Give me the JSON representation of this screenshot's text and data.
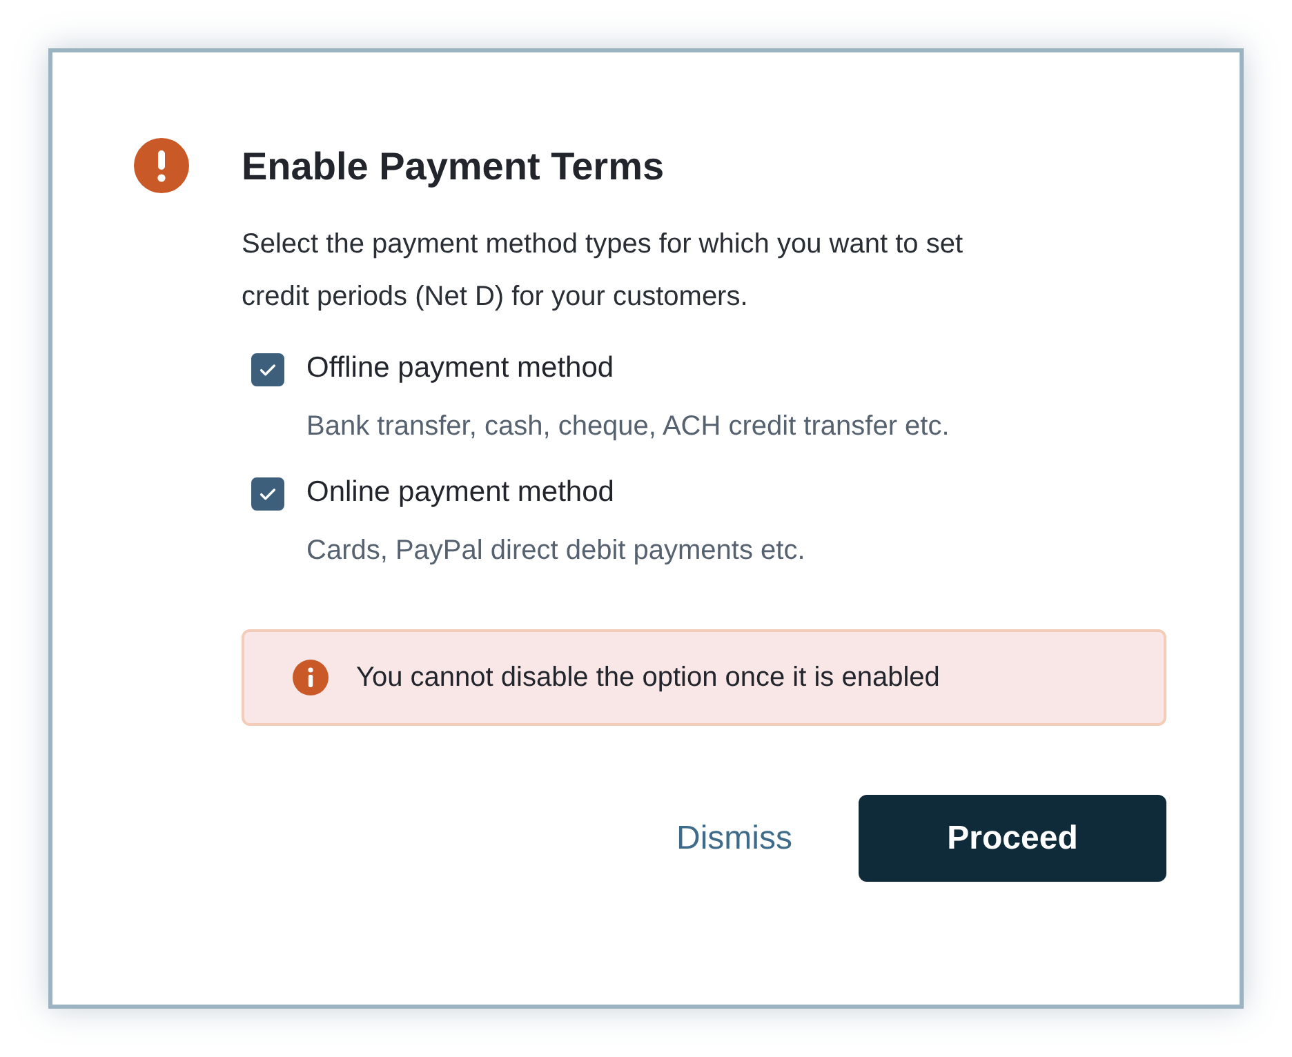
{
  "dialog": {
    "title": "Enable Payment Terms",
    "description": "Select the payment method types for which you want to set credit periods (Net D) for your customers.",
    "options": [
      {
        "label": "Offline payment method",
        "hint": "Bank transfer, cash, cheque, ACH credit transfer etc.",
        "checked": true
      },
      {
        "label": "Online payment method",
        "hint": "Cards, PayPal direct debit payments etc.",
        "checked": true
      }
    ],
    "alert": {
      "message": "You cannot disable the option once it is enabled"
    },
    "buttons": [
      {
        "label": "Dismiss",
        "kind": "secondary"
      },
      {
        "label": "Proceed",
        "kind": "primary"
      }
    ]
  }
}
